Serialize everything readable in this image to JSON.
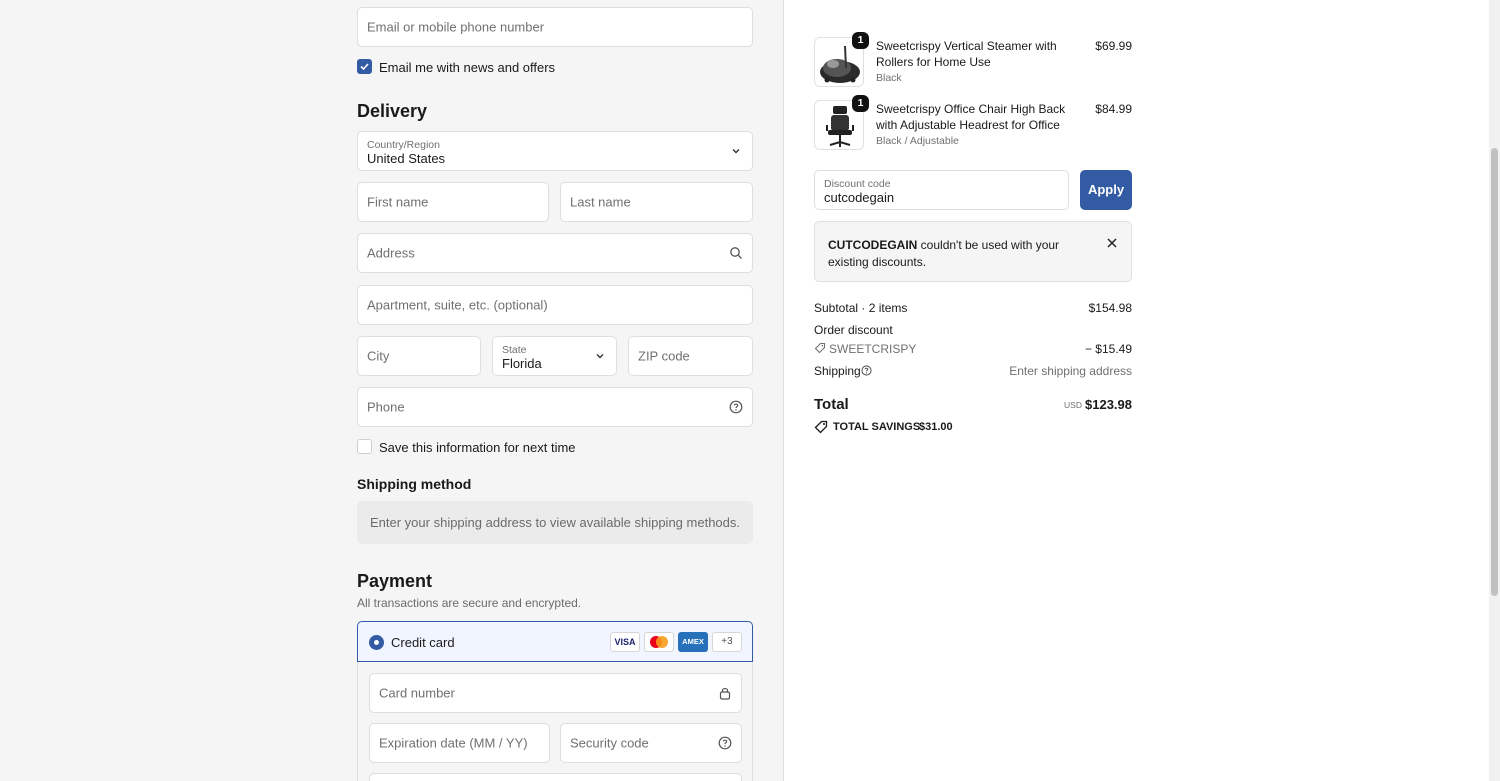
{
  "contact": {
    "email_placeholder": "Email or mobile phone number",
    "news_label": "Email me with news and offers",
    "news_checked": true
  },
  "delivery": {
    "title": "Delivery",
    "country_label": "Country/Region",
    "country_value": "United States",
    "first_name_placeholder": "First name",
    "last_name_placeholder": "Last name",
    "address_placeholder": "Address",
    "apartment_placeholder": "Apartment, suite, etc. (optional)",
    "city_placeholder": "City",
    "state_label": "State",
    "state_value": "Florida",
    "zip_placeholder": "ZIP code",
    "phone_placeholder": "Phone",
    "save_label": "Save this information for next time"
  },
  "shipping_method": {
    "title": "Shipping method",
    "message": "Enter your shipping address to view available shipping methods."
  },
  "payment": {
    "title": "Payment",
    "subtitle": "All transactions are secure and encrypted.",
    "credit_card_label": "Credit card",
    "cards": [
      "VISA",
      "",
      "AMEX",
      "+3"
    ],
    "card_number_placeholder": "Card number",
    "expiration_placeholder": "Expiration date (MM / YY)",
    "security_placeholder": "Security code"
  },
  "summary": {
    "items": [
      {
        "qty": "1",
        "name": "Sweetcrispy Vertical Steamer with Rollers for Home Use",
        "variant": "Black",
        "price": "$69.99",
        "icon": "steamer-image"
      },
      {
        "qty": "1",
        "name": "Sweetcrispy Office Chair High Back with Adjustable Headrest for Office",
        "variant": "Black / Adjustable",
        "price": "$84.99",
        "icon": "chair-image"
      }
    ],
    "discount_label": "Discount code",
    "discount_value": "cutcodegain",
    "apply_label": "Apply",
    "notice_code": "CUTCODEGAIN",
    "notice_text": " couldn't be used with your existing discounts.",
    "subtotal_label": "Subtotal · 2 items",
    "subtotal_value": "$154.98",
    "order_discount_label": "Order discount",
    "discount_code_applied": "SWEETCRISPY",
    "discount_amount": "− $15.49",
    "shipping_label": "Shipping",
    "shipping_value": "Enter shipping address",
    "total_label": "Total",
    "currency": "USD",
    "total_value": "$123.98",
    "savings_label": "TOTAL SAVINGS",
    "savings_value": "$31.00"
  },
  "colors": {
    "accent": "#335ba3",
    "background_left": "#f5f5f5",
    "background_right": "#ffffff"
  }
}
